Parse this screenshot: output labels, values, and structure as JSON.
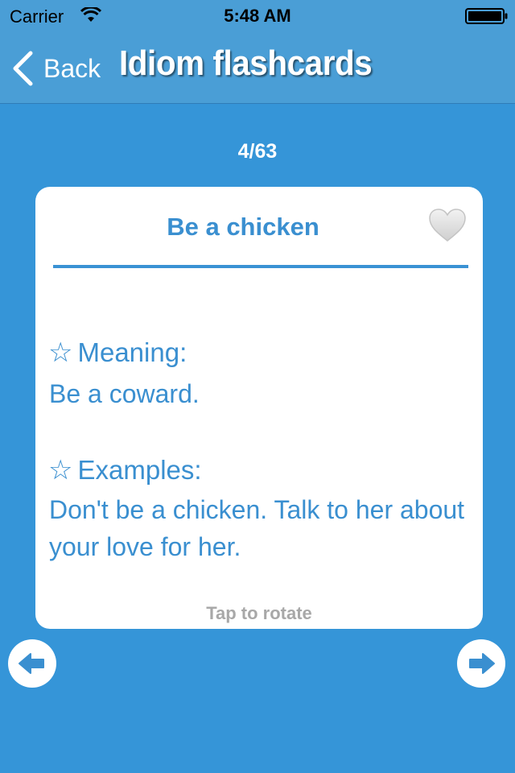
{
  "status_bar": {
    "carrier": "Carrier",
    "time": "5:48 AM",
    "wifi_icon": "wifi-icon",
    "battery_icon": "battery-full-icon"
  },
  "nav_bar": {
    "back_label": "Back",
    "title": "Idiom flashcards",
    "back_icon": "chevron-left-icon"
  },
  "counter": "4/63",
  "card": {
    "title": "Be a chicken",
    "favorite_icon": "heart-icon",
    "meaning_heading": "Meaning:",
    "meaning_text": "Be a coward.",
    "examples_heading": "Examples:",
    "examples_text": "Don't be a chicken. Talk to her about your love for her.",
    "star_glyph": "☆",
    "hint": "Tap to rotate"
  },
  "navigation": {
    "previous_icon": "arrow-left-icon",
    "next_icon": "arrow-right-icon"
  },
  "colors": {
    "background": "#3595d8",
    "bar": "#4a9ed6",
    "accent_text": "#3a8fd0",
    "hint_text": "#a8a8a8"
  }
}
